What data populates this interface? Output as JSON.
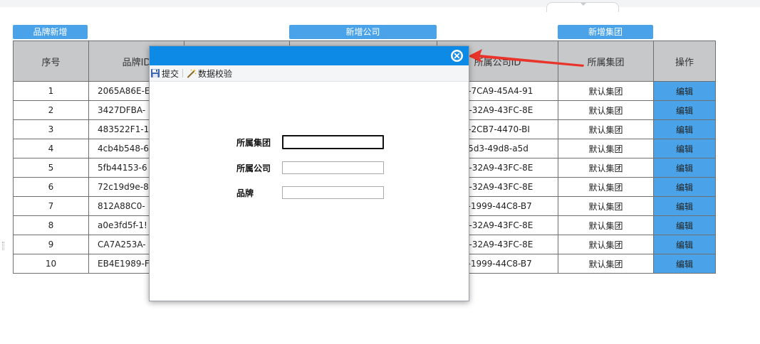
{
  "top_buttons": {
    "brand_add": "品牌新增",
    "company_add": "新增公司",
    "group_add": "新增集团"
  },
  "table": {
    "headers": {
      "index": "序号",
      "brand_id": "品牌ID",
      "company_id": "所属公司ID",
      "group": "所属集团",
      "action": "操作"
    },
    "rows": [
      {
        "index": "1",
        "brand_id": "2065A86E-E",
        "company_id": "A818-7CA9-45A4-91",
        "group": "默认集团",
        "action": "编辑"
      },
      {
        "index": "2",
        "brand_id": "3427DFBA-",
        "company_id": "C6BB-32A9-43FC-8E",
        "group": "默认集团",
        "action": "编辑"
      },
      {
        "index": "3",
        "brand_id": "483522F1-1",
        "company_id": "0A36-2CB7-4470-BI",
        "group": "默认集团",
        "action": "编辑"
      },
      {
        "index": "4",
        "brand_id": "4cb4b548-6",
        "company_id": "fa1-45d3-49d8-a5d",
        "group": "默认集团",
        "action": "编辑"
      },
      {
        "index": "5",
        "brand_id": "5fb44153-6",
        "company_id": "C6BB-32A9-43FC-8E",
        "group": "默认集团",
        "action": "编辑"
      },
      {
        "index": "6",
        "brand_id": "72c19d9e-8",
        "company_id": "C6BB-32A9-43FC-8E",
        "group": "默认集团",
        "action": "编辑"
      },
      {
        "index": "7",
        "brand_id": "812A88C0-",
        "company_id": "251E-1999-44C8-B7",
        "group": "默认集团",
        "action": "编辑"
      },
      {
        "index": "8",
        "brand_id": "a0e3fd5f-1!",
        "company_id": "C6BB-32A9-43FC-8E",
        "group": "默认集团",
        "action": "编辑"
      },
      {
        "index": "9",
        "brand_id": "CA7A253A-",
        "company_id": "C6BB-32A9-43FC-8E",
        "group": "默认集团",
        "action": "编辑"
      },
      {
        "index": "10",
        "brand_id": "EB4E1989-F",
        "company_id": "251E-1999-44C8-B7",
        "group": "默认集团",
        "action": "编辑"
      }
    ]
  },
  "modal": {
    "toolbar": {
      "submit": "提交",
      "validate": "数据校验"
    },
    "form": {
      "group_label": "所属集团",
      "company_label": "所属公司",
      "brand_label": "品牌",
      "group_value": "",
      "company_value": "",
      "brand_value": ""
    }
  },
  "icons": {
    "close": "close-icon",
    "submit": "save-icon",
    "validate": "wand-icon"
  },
  "colors": {
    "accent": "#4aa3e8",
    "modal_title": "#0d8ae6",
    "header_bg": "#c7c8c9",
    "annotation_arrow": "#e8342a"
  }
}
